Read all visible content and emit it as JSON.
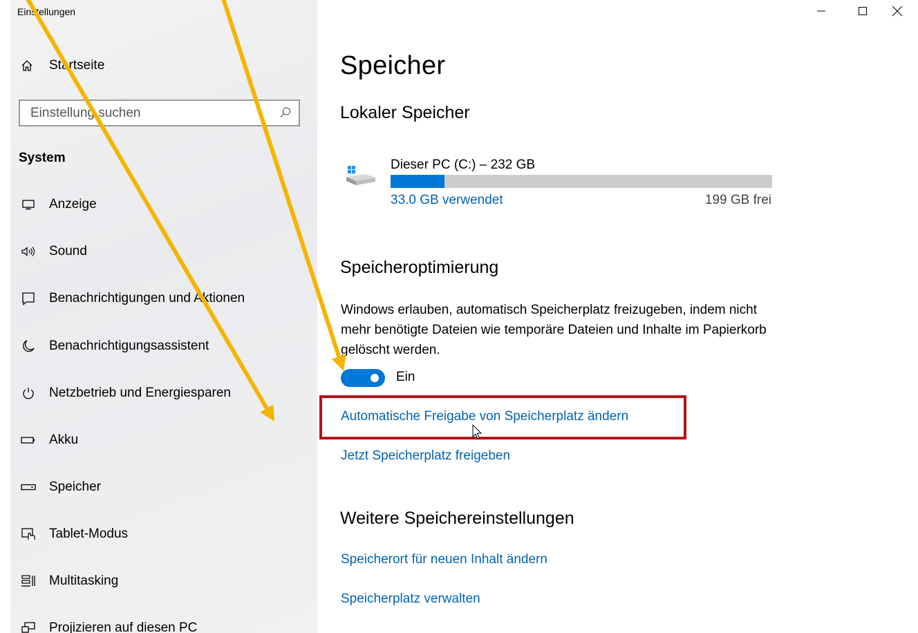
{
  "window": {
    "title": "Einstellungen",
    "controls": {
      "minimize_icon": "minimize-icon",
      "maximize_icon": "maximize-icon",
      "close_icon": "close-icon"
    }
  },
  "sidebar": {
    "home_label": "Startseite",
    "search_placeholder": "Einstellung suchen",
    "section_label": "System",
    "items": [
      {
        "label": "Anzeige",
        "icon": "monitor-icon"
      },
      {
        "label": "Sound",
        "icon": "speaker-icon"
      },
      {
        "label": "Benachrichtigungen und Aktionen",
        "icon": "notification-icon"
      },
      {
        "label": "Benachrichtigungsassistent",
        "icon": "moon-icon"
      },
      {
        "label": "Netzbetrieb und Energiesparen",
        "icon": "power-icon"
      },
      {
        "label": "Akku",
        "icon": "battery-icon"
      },
      {
        "label": "Speicher",
        "icon": "storage-icon"
      },
      {
        "label": "Tablet-Modus",
        "icon": "tablet-mode-icon"
      },
      {
        "label": "Multitasking",
        "icon": "multitasking-icon"
      },
      {
        "label": "Projizieren auf diesen PC",
        "icon": "project-icon"
      }
    ]
  },
  "main": {
    "title": "Speicher",
    "local_storage": {
      "heading": "Lokaler Speicher",
      "drive_name": "Dieser PC (C:) – 232 GB",
      "used_text": "33.0 GB verwendet",
      "free_text": "199 GB frei",
      "used_fraction": 0.142
    },
    "optimization": {
      "heading": "Speicheroptimierung",
      "description": "Windows erlauben, automatisch Speicherplatz freizugeben, indem nicht mehr benötigte Dateien wie temporäre Dateien und Inhalte im Papierkorb gelöscht werden.",
      "toggle_state": "Ein",
      "toggle_on": true,
      "link_change": "Automatische Freigabe von Speicherplatz ändern",
      "link_free_now": "Jetzt Speicherplatz freigeben"
    },
    "more": {
      "heading": "Weitere Speichereinstellungen",
      "link_location": "Speicherort für neuen Inhalt ändern",
      "link_manage": "Speicherplatz verwalten"
    }
  },
  "annotations": {
    "arrow_color": "#f5b400",
    "highlight_color": "#b1151b"
  }
}
